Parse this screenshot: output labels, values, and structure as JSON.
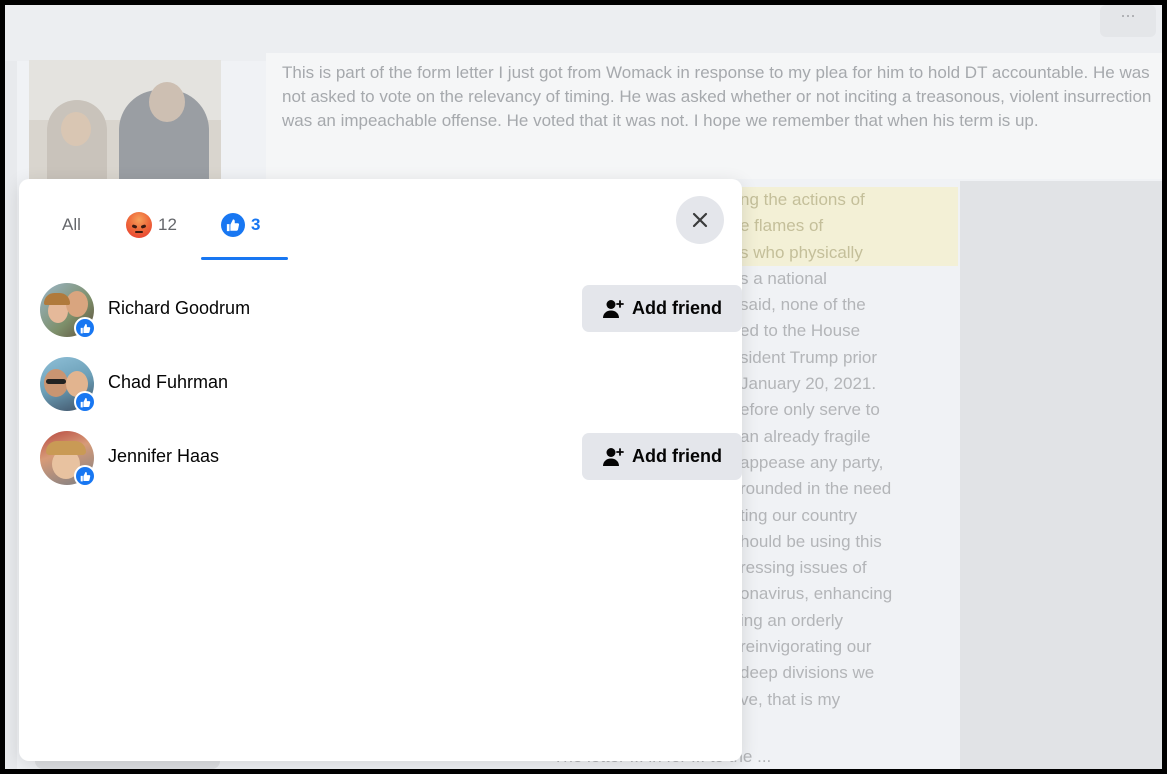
{
  "background": {
    "more_button": "...",
    "post_text": "This is part of the form letter I just got from Womack in response to my plea for him to hold DT accountable. He was not asked to vote on the relevancy of timing. He was asked whether or not inciting a treasonous, violent insurrection was an impeachable offense. He voted that it was not. I hope we remember that when his term is up.",
    "letter_lines": [
      "ng the actions of",
      "e flames of",
      "s who physically",
      "s a national",
      "said, none of the",
      "ed to the House",
      "sident Trump prior",
      "January 20, 2021.",
      "efore only serve to",
      "an already fragile",
      "appease any party,",
      "rounded in the need",
      "ting our country",
      "hould be using this",
      "ressing issues of",
      "onavirus, enhancing",
      "ing an orderly",
      "reinvigorating our",
      "deep divisions we",
      "ve, that is my"
    ],
    "bottom_text": "The letter ... in for ... to the ..."
  },
  "reactions_dialog": {
    "tabs": [
      {
        "label": "All"
      },
      {
        "icon": "angry-reaction-icon",
        "count": "12"
      },
      {
        "icon": "like-reaction-icon",
        "count": "3",
        "selected": true
      }
    ],
    "accent_color": "#1877f2",
    "people": [
      {
        "name": "Richard Goodrum",
        "reaction": "like",
        "action_label": "Add friend"
      },
      {
        "name": "Chad Fuhrman",
        "reaction": "like",
        "action_label": ""
      },
      {
        "name": "Jennifer Haas",
        "reaction": "like",
        "action_label": "Add friend"
      }
    ]
  }
}
